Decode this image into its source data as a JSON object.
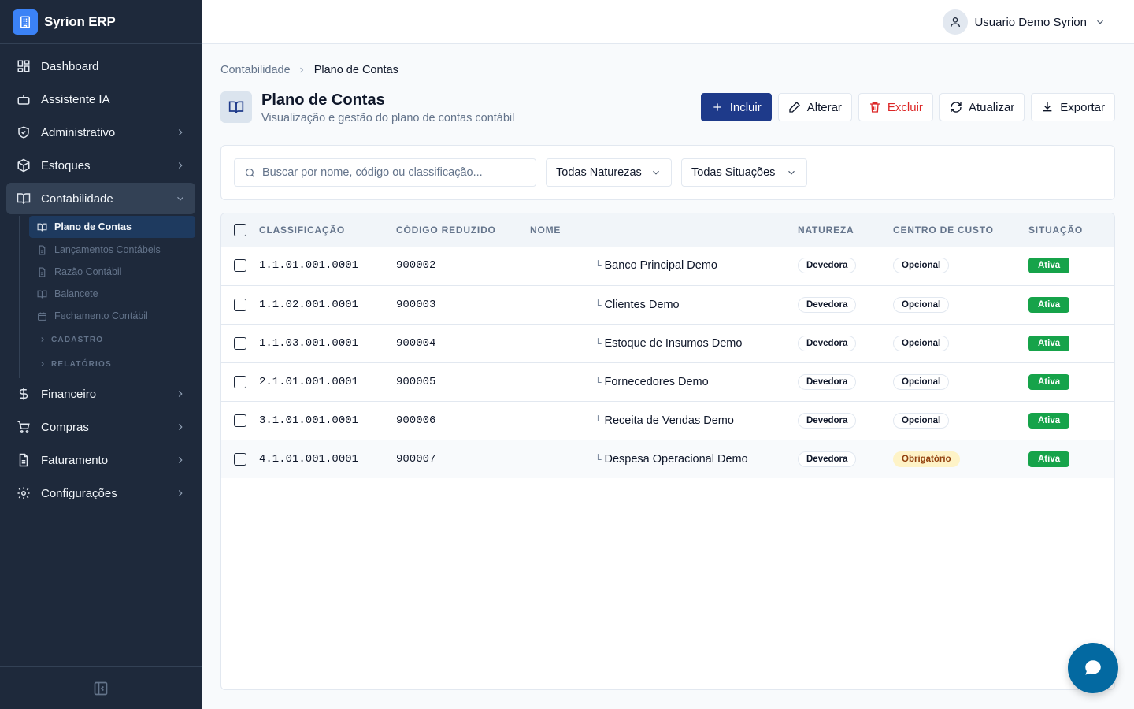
{
  "brand": {
    "name": "Syrion ERP"
  },
  "sidebar": {
    "items": [
      {
        "label": "Dashboard",
        "icon": "dashboard-icon"
      },
      {
        "label": "Assistente IA",
        "icon": "bot-icon"
      },
      {
        "label": "Administrativo",
        "icon": "shield-icon"
      },
      {
        "label": "Estoques",
        "icon": "box-icon"
      },
      {
        "label": "Contabilidade",
        "icon": "book-icon",
        "active": true
      },
      {
        "label": "Financeiro",
        "icon": "dollar-icon"
      },
      {
        "label": "Compras",
        "icon": "cart-icon"
      },
      {
        "label": "Faturamento",
        "icon": "file-icon"
      },
      {
        "label": "Configurações",
        "icon": "gear-icon"
      }
    ],
    "sub_items": [
      {
        "label": "Plano de Contas",
        "active": true
      },
      {
        "label": "Lançamentos Contábeis"
      },
      {
        "label": "Razão Contábil"
      },
      {
        "label": "Balancete"
      },
      {
        "label": "Fechamento Contábil"
      }
    ],
    "groups": [
      "CADASTRO",
      "RELATÓRIOS"
    ]
  },
  "header": {
    "user_name": "Usuario Demo Syrion"
  },
  "breadcrumb": {
    "parent": "Contabilidade",
    "current": "Plano de Contas"
  },
  "page": {
    "title": "Plano de Contas",
    "subtitle": "Visualização e gestão do plano de contas contábil"
  },
  "toolbar": {
    "add": "Incluir",
    "edit": "Alterar",
    "delete": "Excluir",
    "refresh": "Atualizar",
    "export": "Exportar"
  },
  "filters": {
    "search_placeholder": "Buscar por nome, código ou classificação...",
    "nature": "Todas Naturezas",
    "status": "Todas Situações"
  },
  "table": {
    "columns": [
      "CLASSIFICAÇÃO",
      "CÓDIGO REDUZIDO",
      "NOME",
      "NATUREZA",
      "CENTRO DE CUSTO",
      "SITUAÇÃO"
    ],
    "rows": [
      {
        "classificacao": "1.1.01.001.0001",
        "codigo": "900002",
        "nome": "Banco Principal Demo",
        "natureza": "Devedora",
        "centro": "Opcional",
        "situacao": "Ativa"
      },
      {
        "classificacao": "1.1.02.001.0001",
        "codigo": "900003",
        "nome": "Clientes Demo",
        "natureza": "Devedora",
        "centro": "Opcional",
        "situacao": "Ativa"
      },
      {
        "classificacao": "1.1.03.001.0001",
        "codigo": "900004",
        "nome": "Estoque de Insumos Demo",
        "natureza": "Devedora",
        "centro": "Opcional",
        "situacao": "Ativa"
      },
      {
        "classificacao": "2.1.01.001.0001",
        "codigo": "900005",
        "nome": "Fornecedores Demo",
        "natureza": "Devedora",
        "centro": "Opcional",
        "situacao": "Ativa"
      },
      {
        "classificacao": "3.1.01.001.0001",
        "codigo": "900006",
        "nome": "Receita de Vendas Demo",
        "natureza": "Devedora",
        "centro": "Opcional",
        "situacao": "Ativa"
      },
      {
        "classificacao": "4.1.01.001.0001",
        "codigo": "900007",
        "nome": "Despesa Operacional Demo",
        "natureza": "Devedora",
        "centro": "Obrigatório",
        "situacao": "Ativa"
      }
    ]
  },
  "colors": {
    "sidebar": "#1e293b",
    "primary": "#1e3a8a",
    "danger": "#dc2626",
    "success": "#16a34a",
    "warning": "#fef3c7",
    "fab": "#0369a1"
  }
}
